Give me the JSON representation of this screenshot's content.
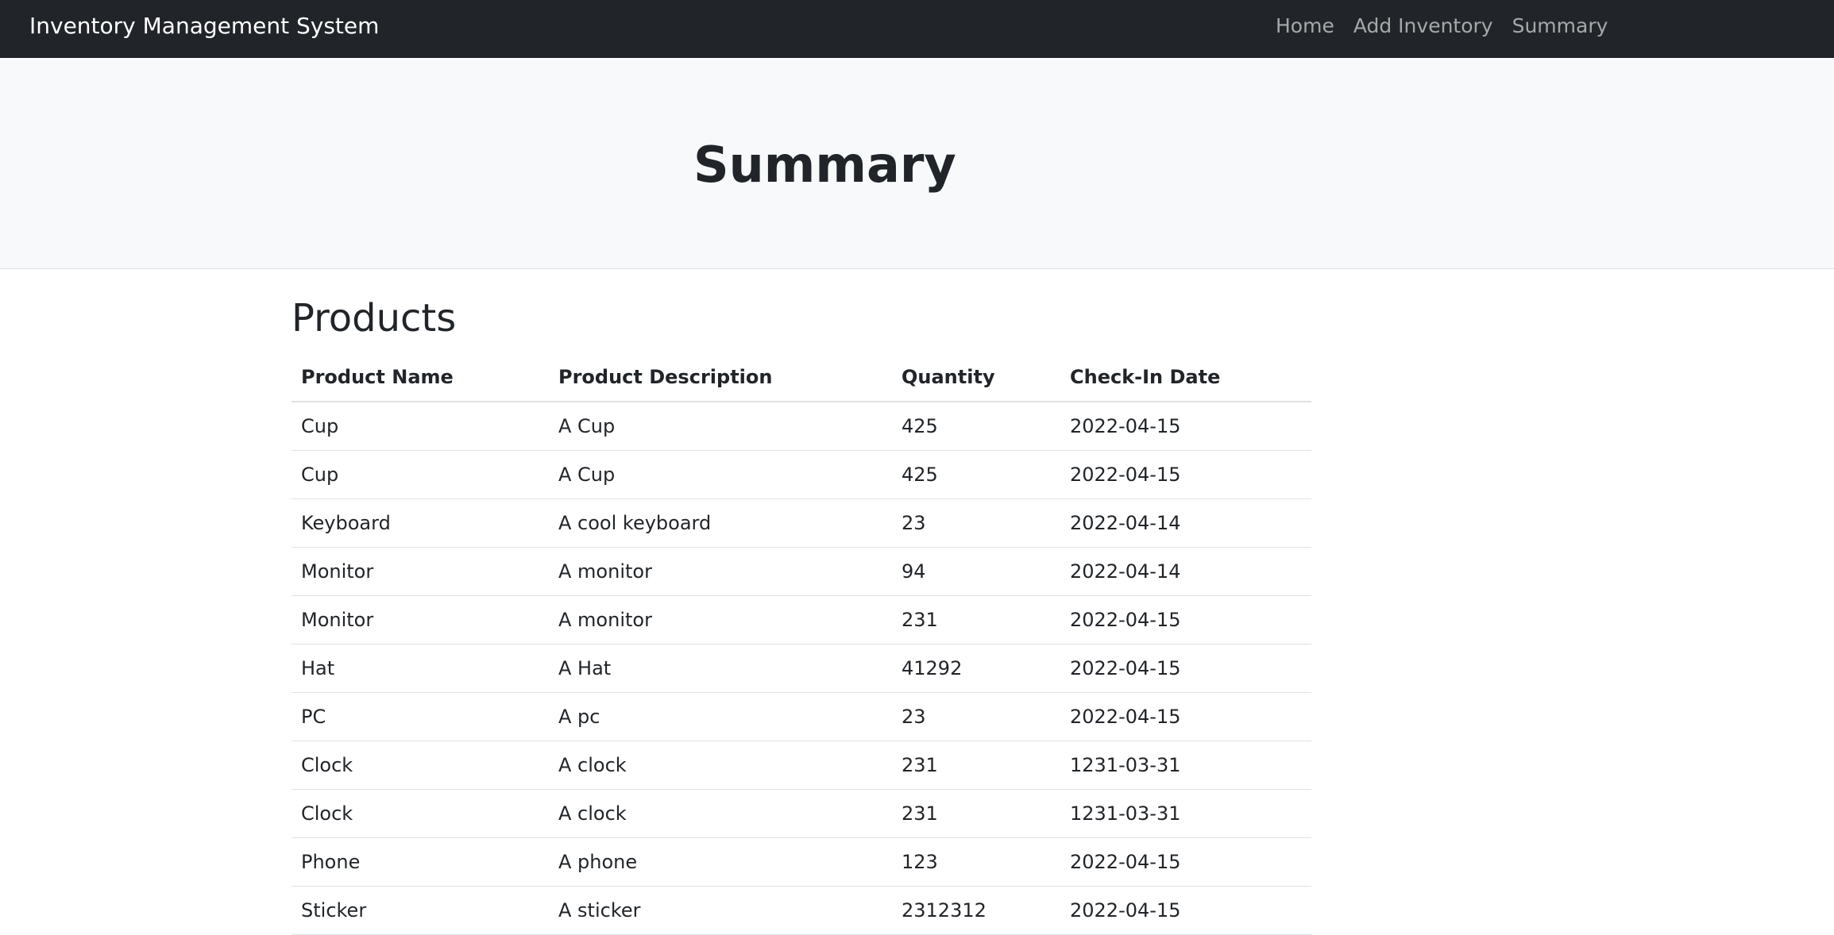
{
  "navbar": {
    "brand": "Inventory Management System",
    "links": [
      "Home",
      "Add Inventory",
      "Summary"
    ]
  },
  "hero": {
    "title": "Summary"
  },
  "products": {
    "heading": "Products",
    "columns": [
      "Product Name",
      "Product Description",
      "Quantity",
      "Check-In Date"
    ],
    "rows": [
      [
        "Cup",
        "A Cup",
        "425",
        "2022-04-15"
      ],
      [
        "Cup",
        "A Cup",
        "425",
        "2022-04-15"
      ],
      [
        "Keyboard",
        "A cool keyboard",
        "23",
        "2022-04-14"
      ],
      [
        "Monitor",
        "A monitor",
        "94",
        "2022-04-14"
      ],
      [
        "Monitor",
        "A monitor",
        "231",
        "2022-04-15"
      ],
      [
        "Hat",
        "A Hat",
        "41292",
        "2022-04-15"
      ],
      [
        "PC",
        "A pc",
        "23",
        "2022-04-15"
      ],
      [
        "Clock",
        "A clock",
        "231",
        "1231-03-31"
      ],
      [
        "Clock",
        "A clock",
        "231",
        "1231-03-31"
      ],
      [
        "Phone",
        "A phone",
        "123",
        "2022-04-15"
      ],
      [
        "Sticker",
        "A sticker",
        "2312312",
        "2022-04-15"
      ]
    ]
  }
}
